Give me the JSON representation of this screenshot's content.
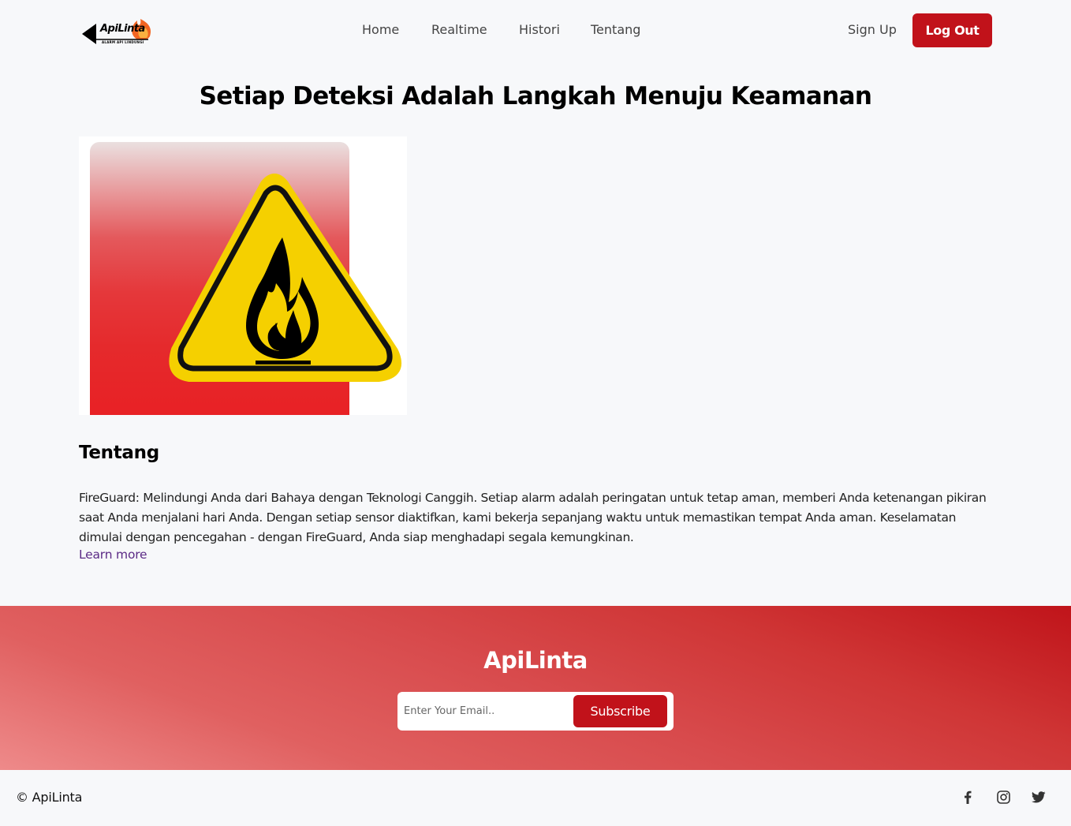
{
  "header": {
    "logo": {
      "name": "ApiLinta",
      "tagline": "ALARM API LINDUNGI"
    },
    "nav": [
      "Home",
      "Realtime",
      "Histori",
      "Tentang"
    ],
    "signup_label": "Sign Up",
    "logout_label": "Log Out"
  },
  "hero": {
    "title": "Setiap Deteksi Adalah Langkah Menuju Keamanan"
  },
  "about": {
    "title": "Tentang",
    "text": "FireGuard: Melindungi Anda dari Bahaya dengan Teknologi Canggih. Setiap alarm adalah peringatan untuk tetap aman, memberi Anda ketenangan pikiran saat Anda menjalani hari Anda. Dengan setiap sensor diaktifkan, kami bekerja sepanjang waktu untuk memastikan tempat Anda aman. Keselamatan dimulai dengan pencegahan - dengan FireGuard, Anda siap menghadapi segala kemungkinan.",
    "learn_more": "Learn more"
  },
  "footer": {
    "brand": "ApiLinta",
    "email_placeholder": "Enter Your Email..",
    "subscribe_label": "Subscribe",
    "copyright": "© ApiLinta",
    "social_icons": [
      "facebook-icon",
      "instagram-icon",
      "twitter-icon"
    ]
  },
  "colors": {
    "accent": "#c1121a",
    "link": "#5b2a86",
    "warning_yellow": "#f5d000"
  }
}
